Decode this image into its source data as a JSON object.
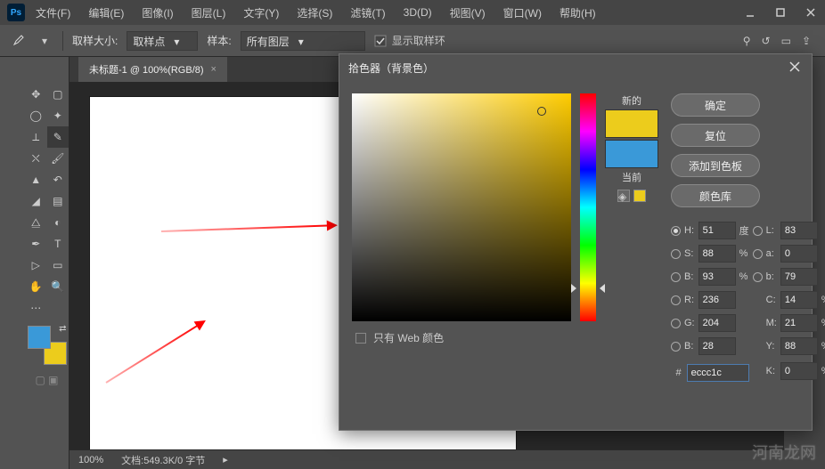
{
  "menubar": {
    "items": [
      "文件(F)",
      "编辑(E)",
      "图像(I)",
      "图层(L)",
      "文字(Y)",
      "选择(S)",
      "滤镜(T)",
      "3D(D)",
      "视图(V)",
      "窗口(W)",
      "帮助(H)"
    ]
  },
  "options": {
    "sample_size_label": "取样大小:",
    "sample_size_value": "取样点",
    "sample_label": "样本:",
    "sample_value": "所有图层",
    "show_ring": "显示取样环"
  },
  "tab": {
    "title": "未标题-1 @ 100%(RGB/8)"
  },
  "status": {
    "zoom": "100%",
    "doc": "文档:549.3K/0 字节"
  },
  "dialog": {
    "title": "拾色器（背景色）",
    "ok": "确定",
    "reset": "复位",
    "add_swatch": "添加到色板",
    "libraries": "颜色库",
    "new_label": "新的",
    "current_label": "当前",
    "web_only": "只有 Web 颜色",
    "hex_label": "#",
    "hex_value": "eccc1c",
    "hsb": {
      "h_label": "H:",
      "s_label": "S:",
      "b_label": "B:",
      "h": "51",
      "s": "88",
      "b": "93",
      "h_unit": "度",
      "pct": "%"
    },
    "rgb": {
      "r_label": "R:",
      "g_label": "G:",
      "b_label": "B:",
      "r": "236",
      "g": "204",
      "b": "28"
    },
    "lab": {
      "l_label": "L:",
      "a_label": "a:",
      "b_label": "b:",
      "l": "83",
      "a": "0",
      "b": "79"
    },
    "cmyk": {
      "c_label": "C:",
      "m_label": "M:",
      "y_label": "Y:",
      "k_label": "K:",
      "c": "14",
      "m": "21",
      "y": "88",
      "k": "0"
    }
  },
  "watermark": "河南龙网"
}
